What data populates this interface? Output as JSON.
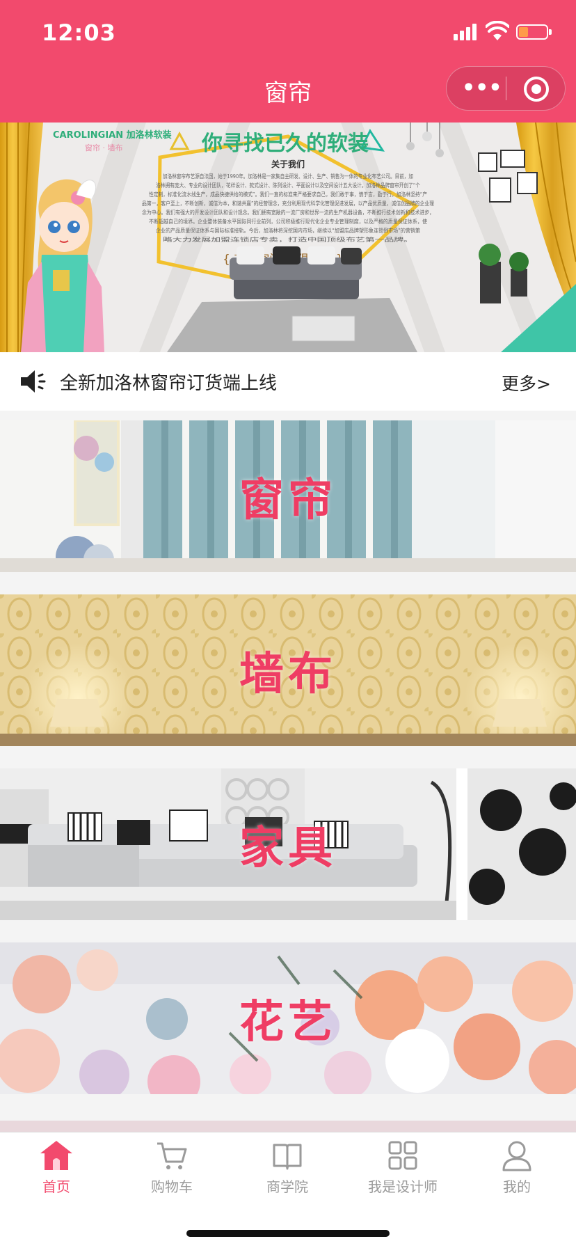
{
  "status_bar": {
    "time": "12:03"
  },
  "nav": {
    "title": "窗帘",
    "more_icon": "•••"
  },
  "banner": {
    "brand": "CAROLINGIAN 加洛林软装",
    "brand_sub": "窗帘 · 墙布",
    "headline": "你寻找已久的软装",
    "about": "关于我们",
    "slogan": "{ 有限空间   无限帘想 }",
    "intro_lines": [
      "加洛林窗帘布艺源自法国，始于1990年。加洛林是一家集自主研发、设计、生产、销售为一体的专业化布艺公司。目前，加",
      "洛林拥有庞大、专业的设计团队，花样设计、款式设计、陈列设计、平面设计以及空间设计五大设计。加洛林品牌窗帘开创了“个",
      "性定制，标准化流水线生产，成品快捷供给的模式”。我们一直的标准来严格要求自己，我们敢于事，慎于言，勤于行。加洛林坚持“产",
      "品第一，客户至上，不断创新，诚信为本，和谐共赢”的经营理念，充分利用现代科学化管理促进发展，以产品优质量，诚信创品牌的企业理",
      "念为中心。我们有强大的开发设计团队和设计观念。我们拥有宽敞的一流厂房和世界一流的生产机器设备，不断推行技术创新和技术进步，",
      "不断超越自己的境界。企业整体装备水平国际同行业前列，公司积极推行现代化企业专业管理制度，以及严格的质量保证体系，使",
      "企业的产品质量保证体系与国际标准接轨。今后，加洛林将深挖国内市场，继续以“加盟店品牌塑形象连锁倒市场”的营销策",
      "略大力发展加盟连锁店专卖，打造中国顶级布艺第一品牌。"
    ]
  },
  "notice": {
    "text": "全新加洛林窗帘订货端上线",
    "more": "更多>"
  },
  "categories": [
    {
      "label": "窗帘"
    },
    {
      "label": "墙布"
    },
    {
      "label": "家具"
    },
    {
      "label": "花艺"
    }
  ],
  "tabbar": {
    "items": [
      {
        "label": "首页",
        "icon": "home-icon",
        "active": true
      },
      {
        "label": "购物车",
        "icon": "cart-icon",
        "active": false
      },
      {
        "label": "商学院",
        "icon": "book-icon",
        "active": false
      },
      {
        "label": "我是设计师",
        "icon": "grid-icon",
        "active": false
      },
      {
        "label": "我的",
        "icon": "user-icon",
        "active": false
      }
    ]
  },
  "colors": {
    "brand": "#f24a6d",
    "label": "#ef3d64",
    "tab_inactive": "#9a9a9a"
  }
}
